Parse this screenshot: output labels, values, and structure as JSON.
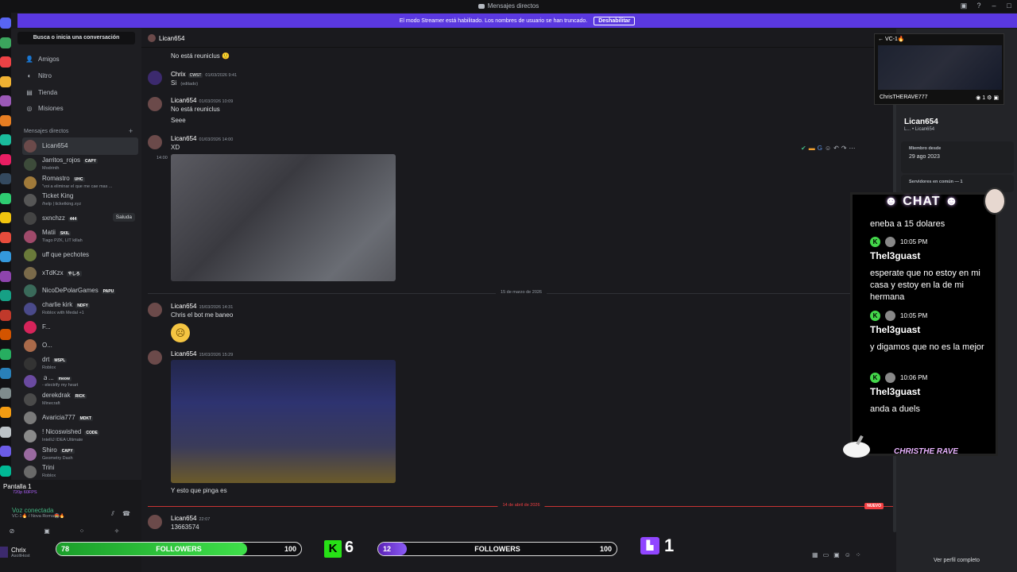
{
  "window": {
    "title": "Mensajes directos"
  },
  "streamer_banner": {
    "text": "El modo Streamer está habilitado. Los nombres de usuario se han truncado.",
    "button": "Deshabilitar"
  },
  "sidebar": {
    "search": "Busca o inicia una conversación",
    "nav": [
      {
        "label": "Amigos",
        "icon": "friends-icon"
      },
      {
        "label": "Nitro",
        "icon": "nitro-icon"
      },
      {
        "label": "Tienda",
        "icon": "shop-icon"
      },
      {
        "label": "Misiones",
        "icon": "quests-icon"
      }
    ],
    "dm_header": "Mensajes directos",
    "dms": [
      {
        "name": "Lican654",
        "sub": "",
        "tag": "",
        "color": "#6b4a4a"
      },
      {
        "name": "Jarritos_rojos",
        "sub": "Modrinth",
        "tag": "CAPY",
        "color": "#3d4b3a"
      },
      {
        "name": "Romastro",
        "sub": "\"voi a eliminar el que me cae mas ...",
        "tag": "UHC",
        "color": "#a07a3a"
      },
      {
        "name": "Ticket King",
        "sub": "/help | ticketking.xyz",
        "tag": "",
        "color": "#565656"
      },
      {
        "name": "sxnchzz",
        "sub": "",
        "tag": "444",
        "color": "#444",
        "wave": "Saluda"
      },
      {
        "name": "Matii",
        "sub": "Tiago PZK, LIT killah",
        "tag": "SKIL",
        "color": "#a04a6a"
      },
      {
        "name": "uff que pechotes",
        "sub": "",
        "tag": "",
        "color": "#6a7a3a"
      },
      {
        "name": "xTdKzx",
        "sub": "",
        "tag": "やしろ",
        "color": "#7a6a4a"
      },
      {
        "name": "NicoDePolarGames",
        "sub": "",
        "tag": "PAPU",
        "color": "#3a6a5a"
      },
      {
        "name": "charlie kirk",
        "sub": "Roblox with Medal +1",
        "tag": "NDFY",
        "color": "#4a4a8a"
      },
      {
        "name": "F...",
        "sub": "",
        "tag": "",
        "color": "#d6245a"
      },
      {
        "name": "O...",
        "sub": "",
        "tag": "",
        "color": "#aa6a4a"
      },
      {
        "name": "drt",
        "sub": "Roblox",
        "tag": "MSPL",
        "color": "#333"
      },
      {
        "name": "ａ...",
        "sub": "- electrify my heart",
        "tag": "meow",
        "color": "#6a4aa0"
      },
      {
        "name": "derekdrak",
        "sub": "Minecraft",
        "tag": "RICK",
        "color": "#4a4a4a"
      },
      {
        "name": "Avaricia777",
        "sub": "",
        "tag": "MDKT",
        "color": "#7a7a7a"
      },
      {
        "name": "! Nicoswished",
        "sub": "IntelliJ IDEA Ultimate",
        "tag": "CODE",
        "color": "#8a8a8a"
      },
      {
        "name": "Shiro",
        "sub": "Geometry Dash",
        "tag": "CAPY",
        "color": "#9a6aa0"
      },
      {
        "name": "Trini",
        "sub": "Roblox",
        "tag": "",
        "color": "#6a6a6a"
      }
    ]
  },
  "panel": {
    "screen": {
      "title": "Pantalla 1",
      "sub": "720p 60FPS"
    },
    "voice": {
      "title": "Voz conectada",
      "sub": "VC-1🔥 / Nova Roma🏟️🔥"
    },
    "user": {
      "name": "Chrix",
      "status": "AsoltHost"
    }
  },
  "chat": {
    "header": "Lican654",
    "messages": [
      {
        "author": "",
        "time": "",
        "body": "No está reuniclus 🙂"
      },
      {
        "author": "Chrix",
        "tag": "CWST",
        "time": "01/03/2026 9:41",
        "body": "Si",
        "edited": "(editado)"
      },
      {
        "author": "Lican654",
        "time": "01/03/2026 10:09",
        "body": "No está reuniclus",
        "body2": "Seee"
      },
      {
        "author": "Lican654",
        "time": "01/03/2026 14:00",
        "body": "XD",
        "side_time": "14:00"
      },
      {
        "author": "Lican654",
        "time": "15/03/2026 14:31",
        "body": "Chris el bot me baneo"
      },
      {
        "author": "Lican654",
        "time": "15/03/2026 15:29",
        "body": "Y esto que pinga es"
      },
      {
        "author": "Lican654",
        "time": "22:07",
        "body": "13663574"
      }
    ],
    "dividers": [
      "15 de marzo de 2026",
      "14 de abril de 2026"
    ],
    "new_badge": "NUEVO"
  },
  "profile": {
    "name": "Lican654",
    "sub": "L... • Lican654",
    "member_since_label": "Miembro desde",
    "member_since": "29 ago 2023",
    "mutual_servers": "Servidores en común — 1",
    "full_profile": "Ver perfil completo"
  },
  "vc_preview": {
    "title": "VC-1🔥",
    "user": "ChrisTHERAVE777",
    "viewers": "1"
  },
  "overlay_chat": {
    "title": "CHAT",
    "footer": "CHRISTHE RAVE",
    "partial": "eneba a 15 dolares",
    "messages": [
      {
        "time": "10:05 PM",
        "user": "Thel3guast",
        "text": "esperate que no estoy en mi casa y estoy en la de mi hermana"
      },
      {
        "time": "10:05 PM",
        "user": "Thel3guast",
        "text": "y digamos que no es la mejor"
      },
      {
        "time": "10:06 PM",
        "user": "Thel3guast",
        "text": "anda a duels"
      }
    ]
  },
  "followers": [
    {
      "current": "78",
      "label": "FOLLOWERS",
      "goal": "100",
      "progress": 0.78,
      "color": "#27c93f"
    },
    {
      "current": "12",
      "label": "FOLLOWERS",
      "goal": "100",
      "progress": 0.12,
      "color": "#7c3aed"
    }
  ],
  "kick": {
    "count": "6"
  },
  "twitch": {
    "count": "1"
  }
}
